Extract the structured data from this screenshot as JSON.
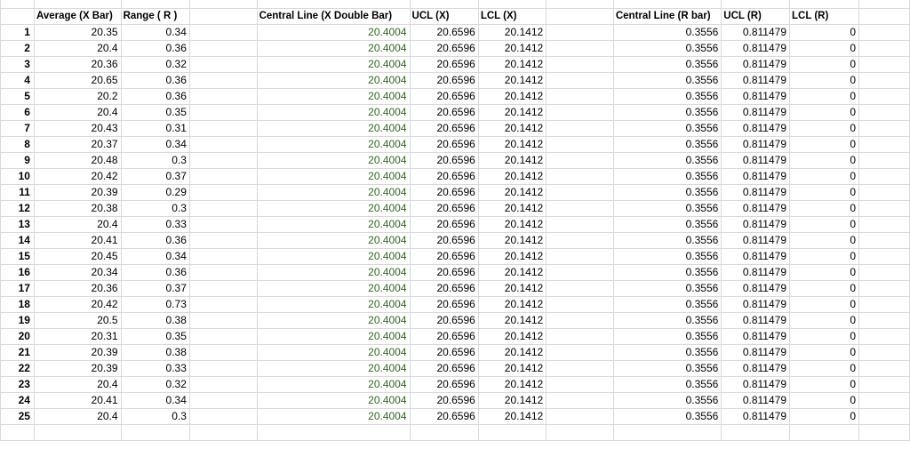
{
  "headers": {
    "average_x_bar": "Average (X Bar)",
    "range_r": "Range ( R )",
    "central_line_x": "Central Line (X Double Bar)",
    "ucl_x": "UCL (X)",
    "lcl_x": "LCL (X)",
    "central_line_r": "Central Line (R bar)",
    "ucl_r": "UCL (R)",
    "lcl_r": "LCL (R)"
  },
  "colors": {
    "central_line_x_text": "#2f6a1c"
  },
  "rows": [
    {
      "n": "1",
      "avg": "20.35",
      "range": "0.34",
      "clx": "20.4004",
      "uclx": "20.6596",
      "lclx": "20.1412",
      "clr": "0.3556",
      "uclr": "0.811479",
      "lclr": "0"
    },
    {
      "n": "2",
      "avg": "20.4",
      "range": "0.36",
      "clx": "20.4004",
      "uclx": "20.6596",
      "lclx": "20.1412",
      "clr": "0.3556",
      "uclr": "0.811479",
      "lclr": "0"
    },
    {
      "n": "3",
      "avg": "20.36",
      "range": "0.32",
      "clx": "20.4004",
      "uclx": "20.6596",
      "lclx": "20.1412",
      "clr": "0.3556",
      "uclr": "0.811479",
      "lclr": "0"
    },
    {
      "n": "4",
      "avg": "20.65",
      "range": "0.36",
      "clx": "20.4004",
      "uclx": "20.6596",
      "lclx": "20.1412",
      "clr": "0.3556",
      "uclr": "0.811479",
      "lclr": "0"
    },
    {
      "n": "5",
      "avg": "20.2",
      "range": "0.36",
      "clx": "20.4004",
      "uclx": "20.6596",
      "lclx": "20.1412",
      "clr": "0.3556",
      "uclr": "0.811479",
      "lclr": "0"
    },
    {
      "n": "6",
      "avg": "20.4",
      "range": "0.35",
      "clx": "20.4004",
      "uclx": "20.6596",
      "lclx": "20.1412",
      "clr": "0.3556",
      "uclr": "0.811479",
      "lclr": "0"
    },
    {
      "n": "7",
      "avg": "20.43",
      "range": "0.31",
      "clx": "20.4004",
      "uclx": "20.6596",
      "lclx": "20.1412",
      "clr": "0.3556",
      "uclr": "0.811479",
      "lclr": "0"
    },
    {
      "n": "8",
      "avg": "20.37",
      "range": "0.34",
      "clx": "20.4004",
      "uclx": "20.6596",
      "lclx": "20.1412",
      "clr": "0.3556",
      "uclr": "0.811479",
      "lclr": "0"
    },
    {
      "n": "9",
      "avg": "20.48",
      "range": "0.3",
      "clx": "20.4004",
      "uclx": "20.6596",
      "lclx": "20.1412",
      "clr": "0.3556",
      "uclr": "0.811479",
      "lclr": "0"
    },
    {
      "n": "10",
      "avg": "20.42",
      "range": "0.37",
      "clx": "20.4004",
      "uclx": "20.6596",
      "lclx": "20.1412",
      "clr": "0.3556",
      "uclr": "0.811479",
      "lclr": "0"
    },
    {
      "n": "11",
      "avg": "20.39",
      "range": "0.29",
      "clx": "20.4004",
      "uclx": "20.6596",
      "lclx": "20.1412",
      "clr": "0.3556",
      "uclr": "0.811479",
      "lclr": "0"
    },
    {
      "n": "12",
      "avg": "20.38",
      "range": "0.3",
      "clx": "20.4004",
      "uclx": "20.6596",
      "lclx": "20.1412",
      "clr": "0.3556",
      "uclr": "0.811479",
      "lclr": "0"
    },
    {
      "n": "13",
      "avg": "20.4",
      "range": "0.33",
      "clx": "20.4004",
      "uclx": "20.6596",
      "lclx": "20.1412",
      "clr": "0.3556",
      "uclr": "0.811479",
      "lclr": "0"
    },
    {
      "n": "14",
      "avg": "20.41",
      "range": "0.36",
      "clx": "20.4004",
      "uclx": "20.6596",
      "lclx": "20.1412",
      "clr": "0.3556",
      "uclr": "0.811479",
      "lclr": "0"
    },
    {
      "n": "15",
      "avg": "20.45",
      "range": "0.34",
      "clx": "20.4004",
      "uclx": "20.6596",
      "lclx": "20.1412",
      "clr": "0.3556",
      "uclr": "0.811479",
      "lclr": "0"
    },
    {
      "n": "16",
      "avg": "20.34",
      "range": "0.36",
      "clx": "20.4004",
      "uclx": "20.6596",
      "lclx": "20.1412",
      "clr": "0.3556",
      "uclr": "0.811479",
      "lclr": "0"
    },
    {
      "n": "17",
      "avg": "20.36",
      "range": "0.37",
      "clx": "20.4004",
      "uclx": "20.6596",
      "lclx": "20.1412",
      "clr": "0.3556",
      "uclr": "0.811479",
      "lclr": "0"
    },
    {
      "n": "18",
      "avg": "20.42",
      "range": "0.73",
      "clx": "20.4004",
      "uclx": "20.6596",
      "lclx": "20.1412",
      "clr": "0.3556",
      "uclr": "0.811479",
      "lclr": "0"
    },
    {
      "n": "19",
      "avg": "20.5",
      "range": "0.38",
      "clx": "20.4004",
      "uclx": "20.6596",
      "lclx": "20.1412",
      "clr": "0.3556",
      "uclr": "0.811479",
      "lclr": "0"
    },
    {
      "n": "20",
      "avg": "20.31",
      "range": "0.35",
      "clx": "20.4004",
      "uclx": "20.6596",
      "lclx": "20.1412",
      "clr": "0.3556",
      "uclr": "0.811479",
      "lclr": "0"
    },
    {
      "n": "21",
      "avg": "20.39",
      "range": "0.38",
      "clx": "20.4004",
      "uclx": "20.6596",
      "lclx": "20.1412",
      "clr": "0.3556",
      "uclr": "0.811479",
      "lclr": "0"
    },
    {
      "n": "22",
      "avg": "20.39",
      "range": "0.33",
      "clx": "20.4004",
      "uclx": "20.6596",
      "lclx": "20.1412",
      "clr": "0.3556",
      "uclr": "0.811479",
      "lclr": "0"
    },
    {
      "n": "23",
      "avg": "20.4",
      "range": "0.32",
      "clx": "20.4004",
      "uclx": "20.6596",
      "lclx": "20.1412",
      "clr": "0.3556",
      "uclr": "0.811479",
      "lclr": "0"
    },
    {
      "n": "24",
      "avg": "20.41",
      "range": "0.34",
      "clx": "20.4004",
      "uclx": "20.6596",
      "lclx": "20.1412",
      "clr": "0.3556",
      "uclr": "0.811479",
      "lclr": "0"
    },
    {
      "n": "25",
      "avg": "20.4",
      "range": "0.3",
      "clx": "20.4004",
      "uclx": "20.6596",
      "lclx": "20.1412",
      "clr": "0.3556",
      "uclr": "0.811479",
      "lclr": "0"
    }
  ]
}
